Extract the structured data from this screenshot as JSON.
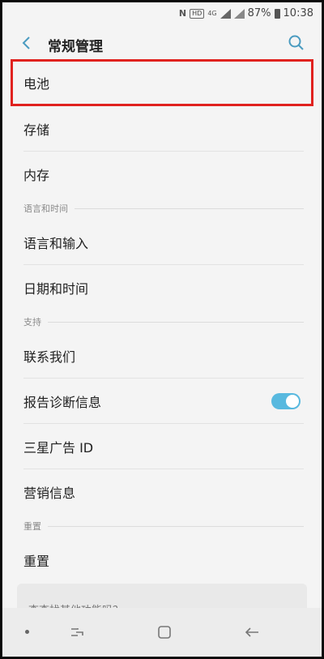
{
  "status_bar": {
    "nfc_label": "N",
    "hd_label": "HD",
    "net_label": "4G",
    "battery": "87%",
    "time": "10:38"
  },
  "header": {
    "title": "常规管理"
  },
  "items": [
    {
      "label": "电池"
    },
    {
      "label": "存储"
    },
    {
      "label": "内存"
    }
  ],
  "sections": {
    "language_time": {
      "title": "语言和时间",
      "items": [
        {
          "label": "语言和输入"
        },
        {
          "label": "日期和时间"
        }
      ]
    },
    "support": {
      "title": "支持",
      "items": [
        {
          "label": "联系我们"
        },
        {
          "label": "报告诊断信息",
          "toggle_on": true
        },
        {
          "label": "三星广告 ID"
        },
        {
          "label": "营销信息"
        }
      ]
    },
    "reset": {
      "title": "重置",
      "items": [
        {
          "label": "重置"
        }
      ]
    }
  },
  "partial_card_text": "查查找其他功能吗？",
  "colors": {
    "highlight_border": "#e0221f",
    "accent": "#58b9df"
  }
}
